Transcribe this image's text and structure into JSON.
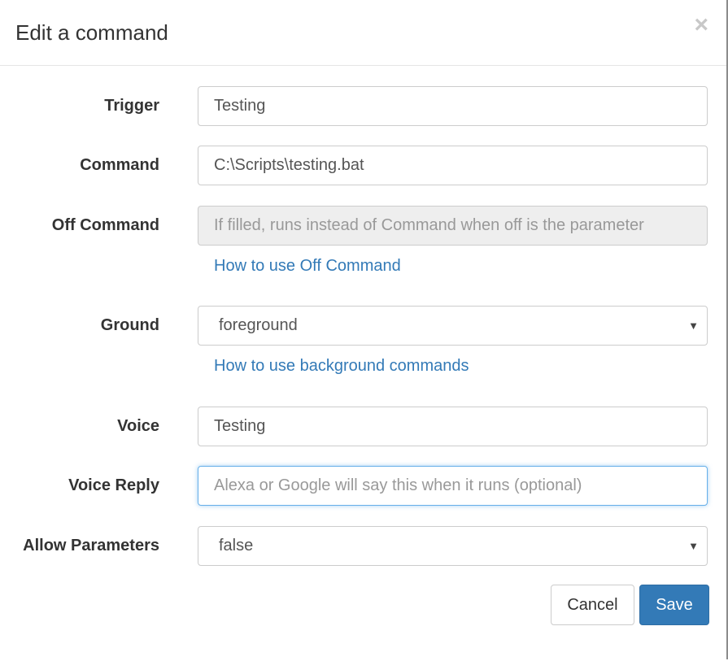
{
  "modal": {
    "title": "Edit a command",
    "close_glyph": "×"
  },
  "form": {
    "trigger": {
      "label": "Trigger",
      "value": "Testing"
    },
    "command": {
      "label": "Command",
      "value": "C:\\Scripts\\testing.bat"
    },
    "off_command": {
      "label": "Off Command",
      "placeholder": "If filled, runs instead of Command when off is the parameter",
      "help_link": "How to use Off Command"
    },
    "ground": {
      "label": "Ground",
      "selected": "foreground",
      "help_link": "How to use background commands"
    },
    "voice": {
      "label": "Voice",
      "value": "Testing"
    },
    "voice_reply": {
      "label": "Voice Reply",
      "placeholder": "Alexa or Google will say this when it runs (optional)"
    },
    "allow_parameters": {
      "label": "Allow Parameters",
      "selected": "false"
    }
  },
  "footer": {
    "cancel_label": "Cancel",
    "save_label": "Save"
  },
  "icons": {
    "close": "close-icon",
    "dropdown": "chevron-down-icon"
  },
  "colors": {
    "link": "#337ab7",
    "primary": "#337ab7",
    "focus_border": "#66afe9",
    "disabled_bg": "#eeeeee"
  }
}
